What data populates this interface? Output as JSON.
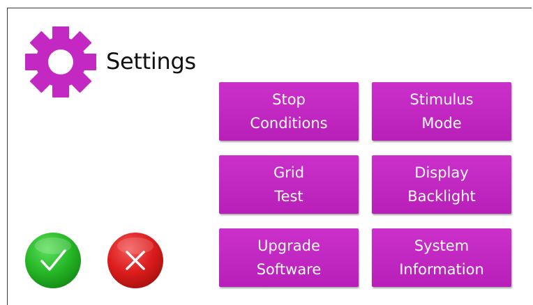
{
  "header": {
    "title": "Settings",
    "icon": "gear-icon",
    "accent_color": "#c328c3"
  },
  "menu": {
    "buttons": [
      {
        "id": "stop-conditions",
        "line1": "Stop",
        "line2": "Conditions"
      },
      {
        "id": "stimulus-mode",
        "line1": "Stimulus",
        "line2": "Mode"
      },
      {
        "id": "grid-test",
        "line1": "Grid",
        "line2": "Test"
      },
      {
        "id": "display-backlight",
        "line1": "Display",
        "line2": "Backlight"
      },
      {
        "id": "upgrade-software",
        "line1": "Upgrade",
        "line2": "Software"
      },
      {
        "id": "system-information",
        "line1": "System",
        "line2": "Information"
      }
    ],
    "button_color": "#c328c3"
  },
  "actions": {
    "confirm": {
      "icon": "checkmark-icon",
      "color": "#22b422"
    },
    "cancel": {
      "icon": "close-icon",
      "color": "#de1a1a"
    }
  }
}
